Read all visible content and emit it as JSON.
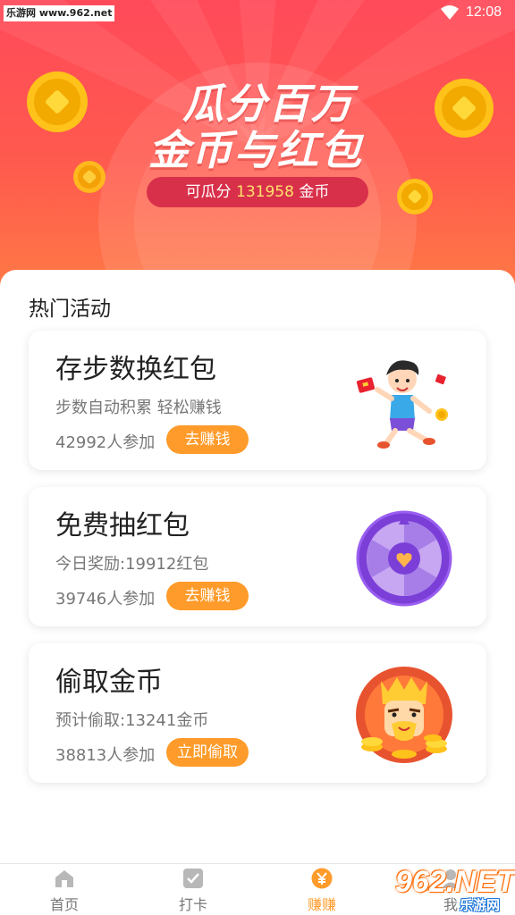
{
  "status_bar": {
    "watermark": "乐游网 www.962.net",
    "time": "12:08"
  },
  "banner": {
    "headline_line1": "瓜分百万",
    "headline_line2": "金币与红包",
    "pool_prefix": "可瓜分",
    "pool_amount": "131958",
    "pool_suffix": "金币",
    "colors": {
      "top": "#ff4a5a",
      "bottom": "#ff7a45",
      "pill": "#d8304a",
      "amount": "#ffe36b"
    }
  },
  "section": {
    "title": "热门活动"
  },
  "activities": [
    {
      "title": "存步数换红包",
      "desc": "步数自动积累 轻松赚钱",
      "participants": "42992人参加",
      "button": "去赚钱",
      "art_icon": "running-boy-icon"
    },
    {
      "title": "免费抽红包",
      "desc": "今日奖励:19912红包",
      "participants": "39746人参加",
      "button": "去赚钱",
      "art_icon": "prize-wheel-icon"
    },
    {
      "title": "偷取金币",
      "desc": "预计偷取:13241金币",
      "participants": "38813人参加",
      "button": "立即偷取",
      "art_icon": "king-with-coins-icon"
    }
  ],
  "bottom_nav": {
    "items": [
      {
        "label": "首页",
        "icon": "home-icon",
        "active": false
      },
      {
        "label": "打卡",
        "icon": "checkin-icon",
        "active": false
      },
      {
        "label": "赚赚",
        "icon": "yen-coin-icon",
        "active": true
      },
      {
        "label": "我",
        "icon": "profile-icon",
        "active": false
      }
    ],
    "active_color": "#ff9b2a"
  },
  "corner_watermark": {
    "big": "962.NET",
    "small": "乐游网"
  }
}
